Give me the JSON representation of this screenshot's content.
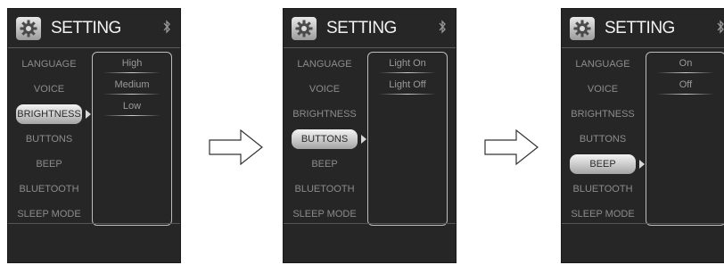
{
  "screens": [
    {
      "title": "SETTING",
      "menu": [
        "LANGUAGE",
        "VOICE",
        "BRIGHTNESS",
        "BUTTONS",
        "BEEP",
        "BLUETOOTH",
        "SLEEP MODE"
      ],
      "selected": "BRIGHTNESS",
      "submenu": [
        "High",
        "Medium",
        "Low"
      ]
    },
    {
      "title": "SETTING",
      "menu": [
        "LANGUAGE",
        "VOICE",
        "BRIGHTNESS",
        "BUTTONS",
        "BEEP",
        "BLUETOOTH",
        "SLEEP MODE"
      ],
      "selected": "BUTTONS",
      "submenu": [
        "Light On",
        "Light Off"
      ]
    },
    {
      "title": "SETTING",
      "menu": [
        "LANGUAGE",
        "VOICE",
        "BRIGHTNESS",
        "BUTTONS",
        "BEEP",
        "BLUETOOTH",
        "SLEEP MODE"
      ],
      "selected": "BEEP",
      "submenu": [
        "On",
        "Off"
      ]
    }
  ],
  "icons": {
    "gear": "gear-icon",
    "bluetooth": "bluetooth-icon",
    "arrow": "right-arrow-icon"
  },
  "colors": {
    "screen_bg": "#262626",
    "text": "#8c8c8c",
    "title": "#f2f2f2"
  }
}
